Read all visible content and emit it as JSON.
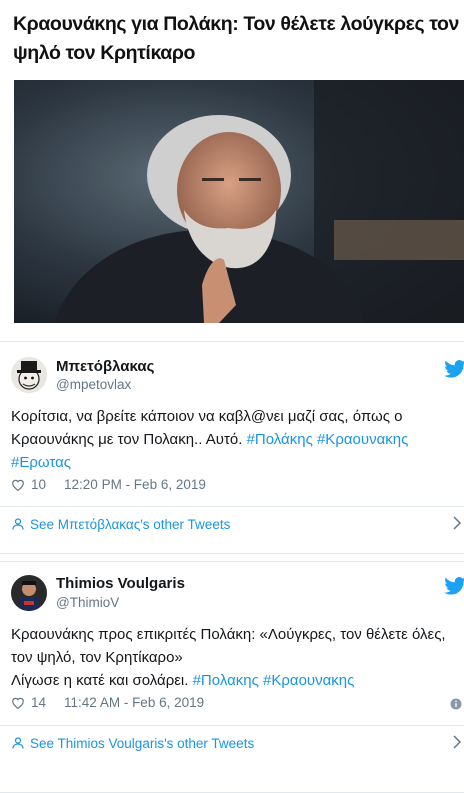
{
  "article": {
    "headline_line1": "Κραουνάκης για Πολάκη: Τον θέλετε λούγκρες τον",
    "headline_line2": "ψηλό τον Κρητίκαρο"
  },
  "tweets": [
    {
      "name": "Μπετόβλακας",
      "handle": "@mpetovlax",
      "text_plain": "Κορίτσια, να βρείτε κάποιον να καβλ@νει μαζί σας, όπως ο Κραουνάκης με τον Πολακη.. Αυτό. ",
      "hashtags": [
        "#Πολάκης",
        "#Κραουνακης",
        "#Ερωτας"
      ],
      "likes": "10",
      "timestamp": "12:20 PM - Feb 6, 2019",
      "other_tweets_label": "See Μπετόβλακας's other Tweets"
    },
    {
      "name": "Thimios Voulgaris",
      "handle": "@ThimioV",
      "text_line1": "Κραουνάκης προς επικριτές Πολάκη: «Λούγκρες, τον θέλετε όλες,",
      "text_line2": "τον ψηλό, τον Κρητίκαρο»",
      "text_line3": "Λίγωσε η κατέ και σολάρει. ",
      "hashtags": [
        "#Πολακης",
        "#Κραουνακης"
      ],
      "likes": "14",
      "timestamp": "11:42 AM - Feb 6, 2019",
      "other_tweets_label": "See Thimios Voulgaris's other Tweets"
    }
  ],
  "icons": {
    "like": "heart-icon",
    "brand": "twitter-bird-icon",
    "person": "person-icon",
    "more": "chevron-right-icon",
    "info": "info-icon"
  },
  "colors": {
    "link": "#1b95e0",
    "muted": "#657786",
    "border": "#e1e8ed"
  }
}
